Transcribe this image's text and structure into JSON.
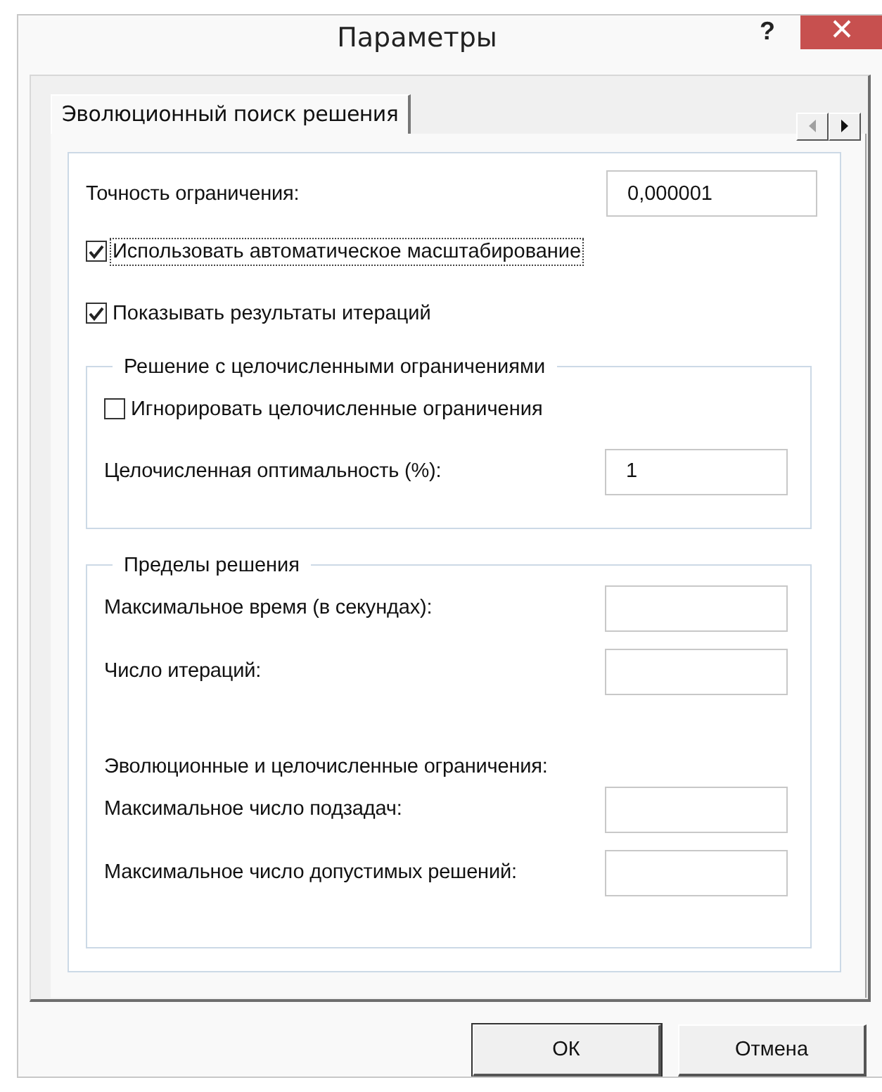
{
  "window": {
    "title": "Параметры",
    "help": "?"
  },
  "tabs": [
    {
      "label": "Эволюционный поиск решения",
      "selected": true
    }
  ],
  "settings": [
    {
      "kind": "field",
      "label": "Точность ограничения:",
      "value": "0,000001"
    },
    {
      "kind": "checkbox",
      "label": "Использовать автоматическое масштабирование",
      "checked": true,
      "focused": true
    },
    {
      "kind": "checkbox",
      "label": "Показывать результаты итераций",
      "checked": true,
      "focused": false
    }
  ],
  "groups": [
    {
      "title": "Решение с целочисленными ограничениями",
      "items": [
        {
          "kind": "checkbox",
          "label": "Игнорировать целочисленные ограничения",
          "checked": false,
          "focused": false
        },
        {
          "kind": "field",
          "label": "Целочисленная оптимальность (%):",
          "value": "1"
        }
      ]
    },
    {
      "title": "Пределы решения",
      "items": [
        {
          "kind": "field",
          "label": "Максимальное время (в секундах):",
          "value": ""
        },
        {
          "kind": "field",
          "label": "Число итераций:",
          "value": ""
        },
        {
          "kind": "heading",
          "label": "Эволюционные и целочисленные ограничения:"
        },
        {
          "kind": "field",
          "label": "Максимальное число подзадач:",
          "value": ""
        },
        {
          "kind": "field",
          "label": "Максимальное число допустимых решений:",
          "value": ""
        }
      ]
    }
  ],
  "buttons": [
    {
      "label": "ОК"
    },
    {
      "label": "Отмена"
    }
  ]
}
